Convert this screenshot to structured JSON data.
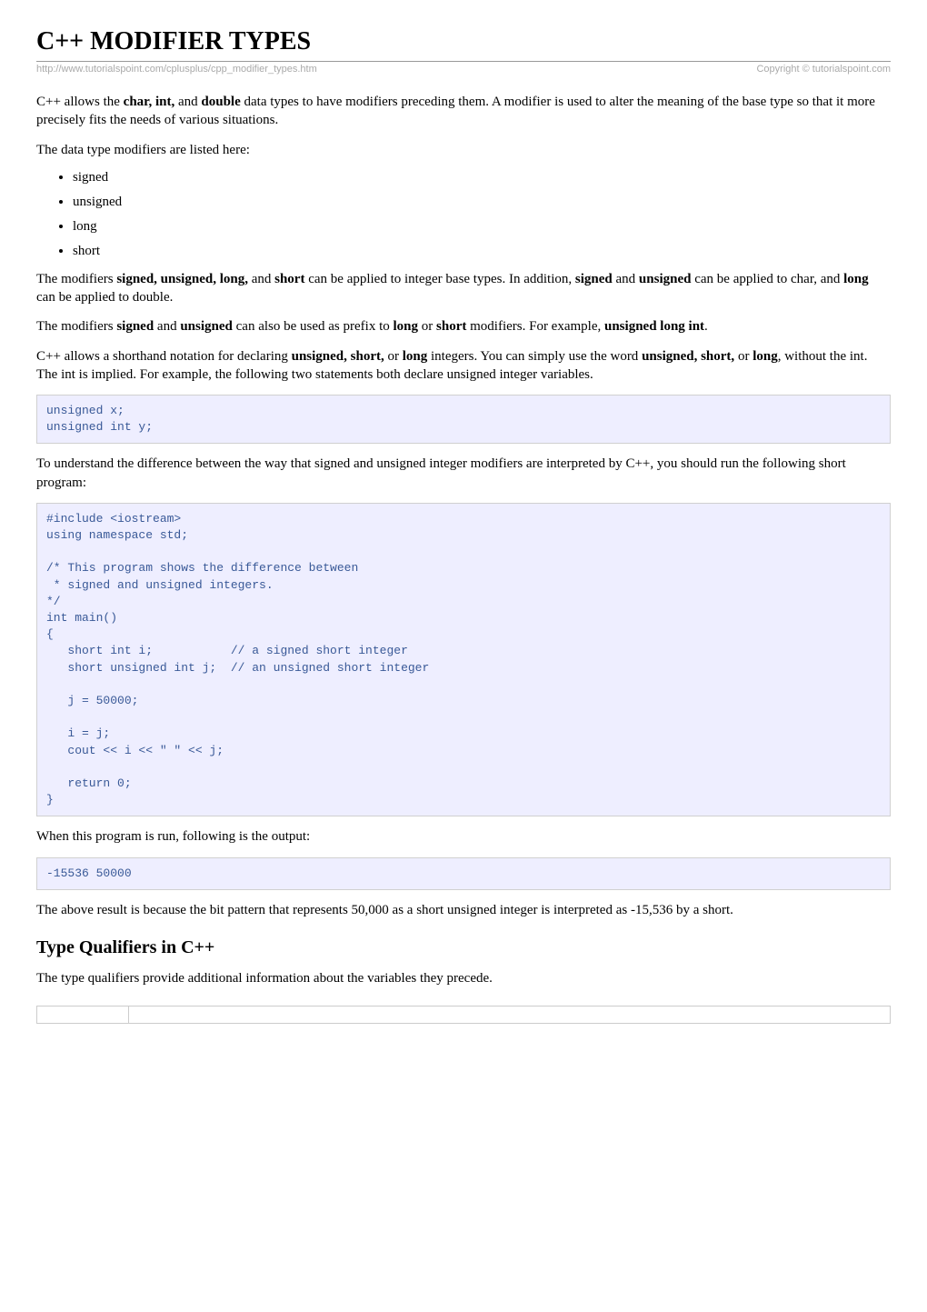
{
  "title": "C++ MODIFIER TYPES",
  "url": "http://www.tutorialspoint.com/cplusplus/cpp_modifier_types.htm",
  "copyright": "Copyright © tutorialspoint.com",
  "paragraphs": {
    "p1_a": "C++ allows the ",
    "p1_b": "char, int,",
    "p1_c": " and ",
    "p1_d": "double",
    "p1_e": " data types to have modifiers preceding them. A modifier is used to alter the meaning of the base type so that it more precisely fits the needs of various situations.",
    "p2": "The data type modifiers are listed here:",
    "p3_a": "The modifiers ",
    "p3_b": "signed, unsigned, long,",
    "p3_c": " and ",
    "p3_d": "short",
    "p3_e": " can be applied to integer base types. In addition, ",
    "p3_f": "signed",
    "p3_g": " and ",
    "p3_h": "unsigned",
    "p3_i": " can be applied to char, and ",
    "p3_j": "long",
    "p3_k": " can be applied to double.",
    "p4_a": "The modifiers ",
    "p4_b": "signed",
    "p4_c": " and ",
    "p4_d": "unsigned",
    "p4_e": " can also be used as prefix to ",
    "p4_f": "long",
    "p4_g": " or ",
    "p4_h": "short",
    "p4_i": " modifiers. For example, ",
    "p4_j": "unsigned long int",
    "p4_k": ".",
    "p5_a": "C++ allows a shorthand notation for declaring ",
    "p5_b": "unsigned, short,",
    "p5_c": " or ",
    "p5_d": "long",
    "p5_e": " integers. You can simply use the word ",
    "p5_f": "unsigned, short,",
    "p5_g": " or ",
    "p5_h": "long",
    "p5_i": ", without the int. The int is implied. For example, the following two statements both declare unsigned integer variables.",
    "p6": "To understand the difference between the way that signed and unsigned integer modifiers are interpreted by C++, you should run the following short program:",
    "p7": "When this program is run, following is the output:",
    "p8": "The above result is because the bit pattern that represents 50,000 as a short unsigned integer is interpreted as -15,536 by a short.",
    "p9": "The type qualifiers provide additional information about the variables they precede."
  },
  "modifiers_list": [
    "signed",
    "unsigned",
    "long",
    "short"
  ],
  "code1": "unsigned x;\nunsigned int y;",
  "code2": "#include <iostream>\nusing namespace std;\n \n/* This program shows the difference between\n * signed and unsigned integers.\n*/\nint main()\n{\n   short int i;           // a signed short integer\n   short unsigned int j;  // an unsigned short integer\n\n   j = 50000;\n\n   i = j;\n   cout << i << \" \" << j;\n\n   return 0;\n}",
  "code3": "-15536 50000",
  "section_heading": "Type Qualifiers in C++"
}
